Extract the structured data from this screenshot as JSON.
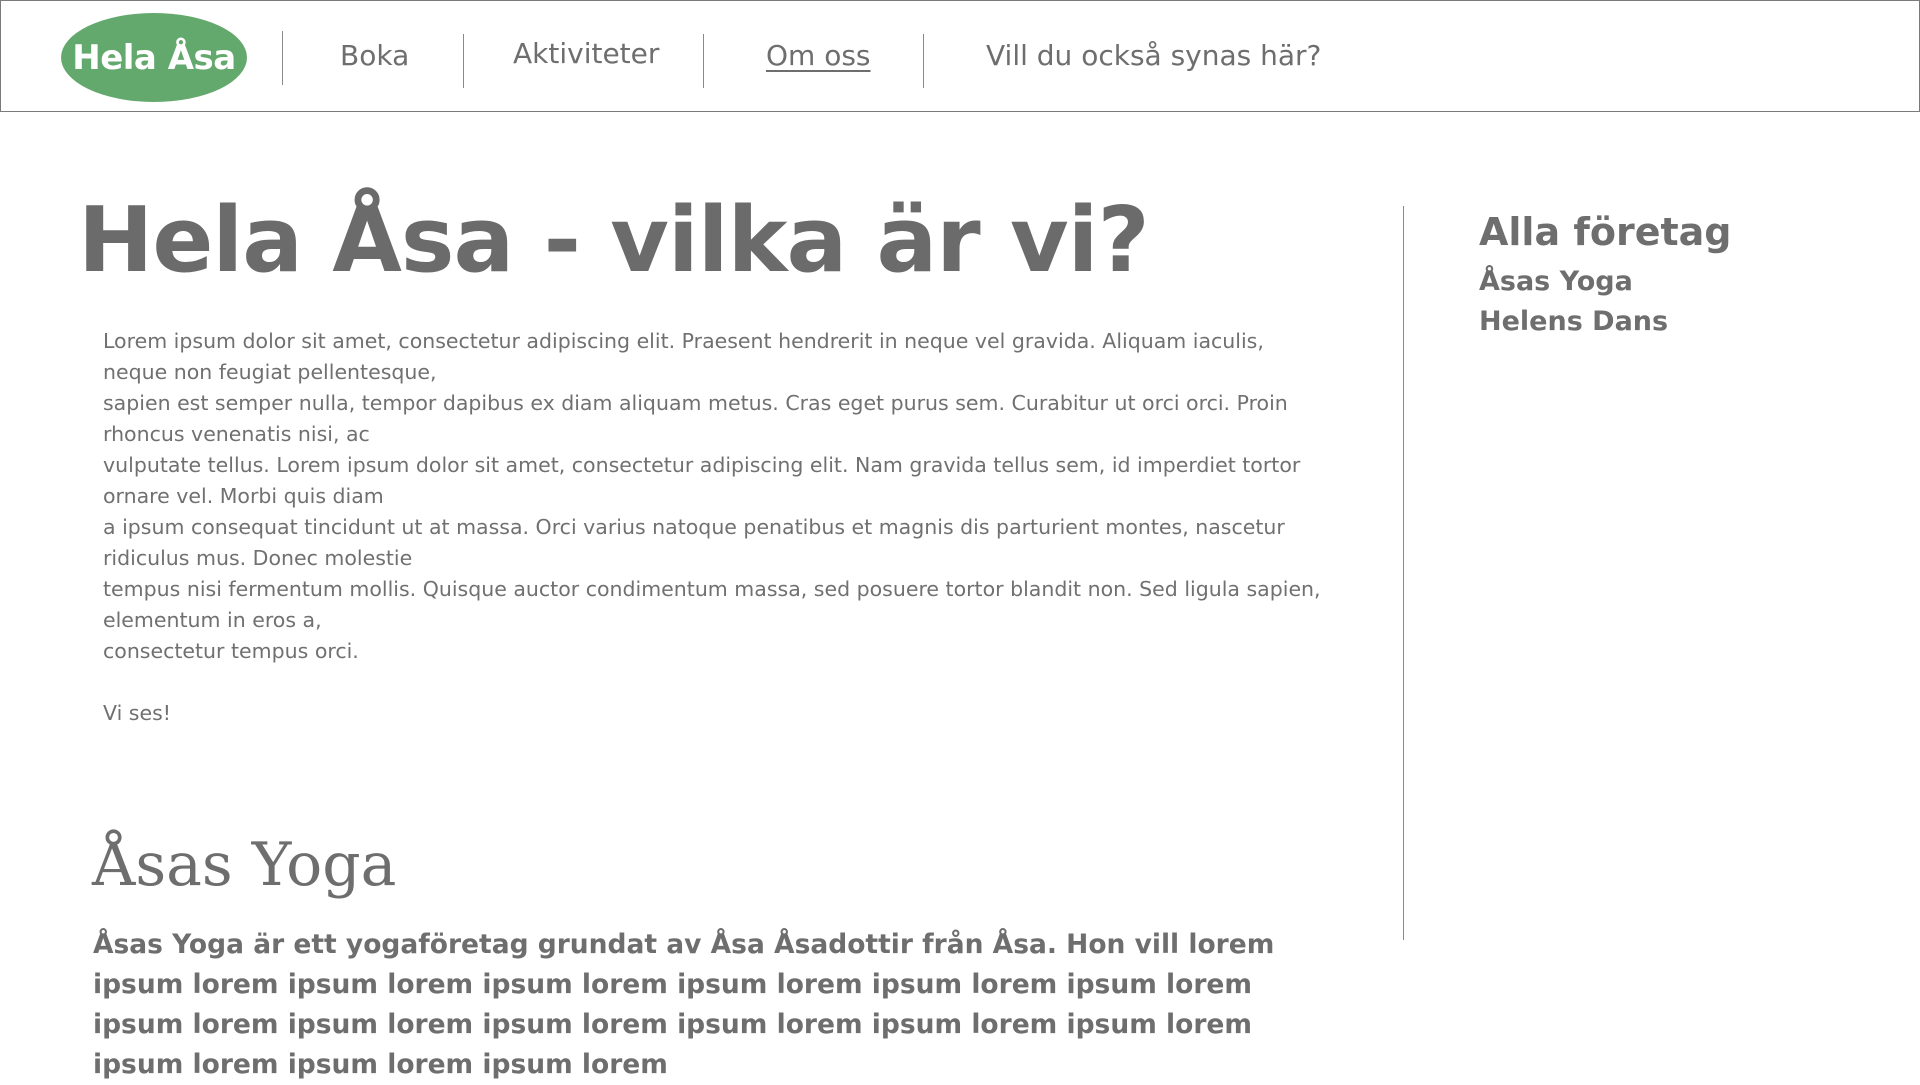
{
  "nav": {
    "logo_text": "Hela Åsa",
    "links": [
      {
        "label": "Boka"
      },
      {
        "label": "Aktiviteter"
      },
      {
        "label": "Om oss"
      },
      {
        "label": "Vill du också synas här?"
      }
    ],
    "active": "Om oss"
  },
  "main": {
    "title": "Hela Åsa - vilka är vi?",
    "intro_lines": [
      "Lorem ipsum dolor sit amet, consectetur adipiscing elit. Praesent hendrerit in neque vel gravida. Aliquam iaculis, neque non feugiat pellentesque,",
      "sapien est semper nulla, tempor dapibus ex diam aliquam metus. Cras eget purus sem. Curabitur ut orci orci. Proin rhoncus venenatis nisi, ac",
      "vulputate tellus. Lorem ipsum dolor sit amet, consectetur adipiscing elit. Nam gravida tellus sem, id imperdiet tortor ornare vel. Morbi quis diam",
      "a ipsum consequat tincidunt ut at massa. Orci varius natoque penatibus et magnis dis parturient montes, nascetur ridiculus mus. Donec molestie",
      "tempus nisi fermentum mollis. Quisque auctor condimentum massa, sed posuere tortor blandit non. Sed ligula sapien, elementum in eros a,",
      "consectetur tempus orci."
    ],
    "sign_off": "Vi ses!",
    "section": {
      "title": "Åsas Yoga",
      "description": "Åsas Yoga är ett yogaföretag grundat av Åsa Åsadottir från Åsa. Hon vill lorem ipsum lorem ipsum lorem ipsum lorem ipsum lorem ipsum lorem ipsum lorem ipsum lorem ipsum lorem ipsum lorem ipsum lorem ipsum lorem ipsum lorem ipsum lorem ipsum lorem ipsum lorem"
    }
  },
  "sidebar": {
    "heading": "Alla företag",
    "companies": [
      {
        "label": "Åsas Yoga"
      },
      {
        "label": "Helens Dans"
      }
    ]
  }
}
